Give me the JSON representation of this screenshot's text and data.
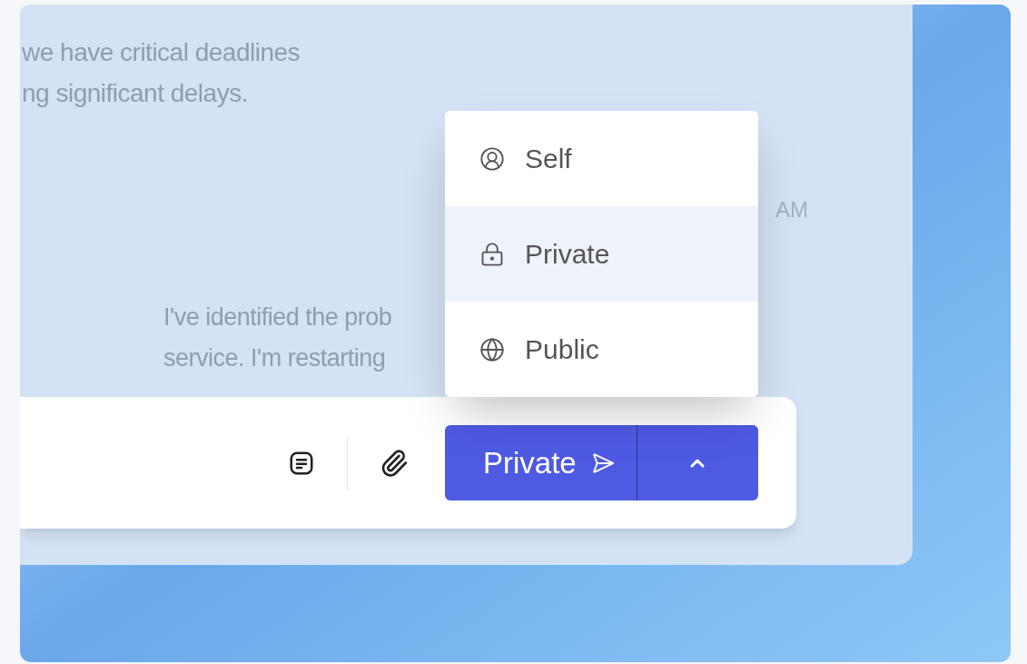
{
  "conversation": {
    "messages": [
      {
        "lines": [
          "we have critical deadlines",
          "ng significant delays."
        ]
      },
      {
        "lines": [
          "I've identified the prob",
          "service. I'm restarting"
        ]
      }
    ],
    "timestamp": "AM"
  },
  "visibility_menu": {
    "items": [
      {
        "kind": "self",
        "label": "Self",
        "selected": false
      },
      {
        "kind": "private",
        "label": "Private",
        "selected": true
      },
      {
        "kind": "public",
        "label": "Public",
        "selected": false
      }
    ]
  },
  "composer": {
    "send_button": {
      "label": "Private"
    }
  }
}
